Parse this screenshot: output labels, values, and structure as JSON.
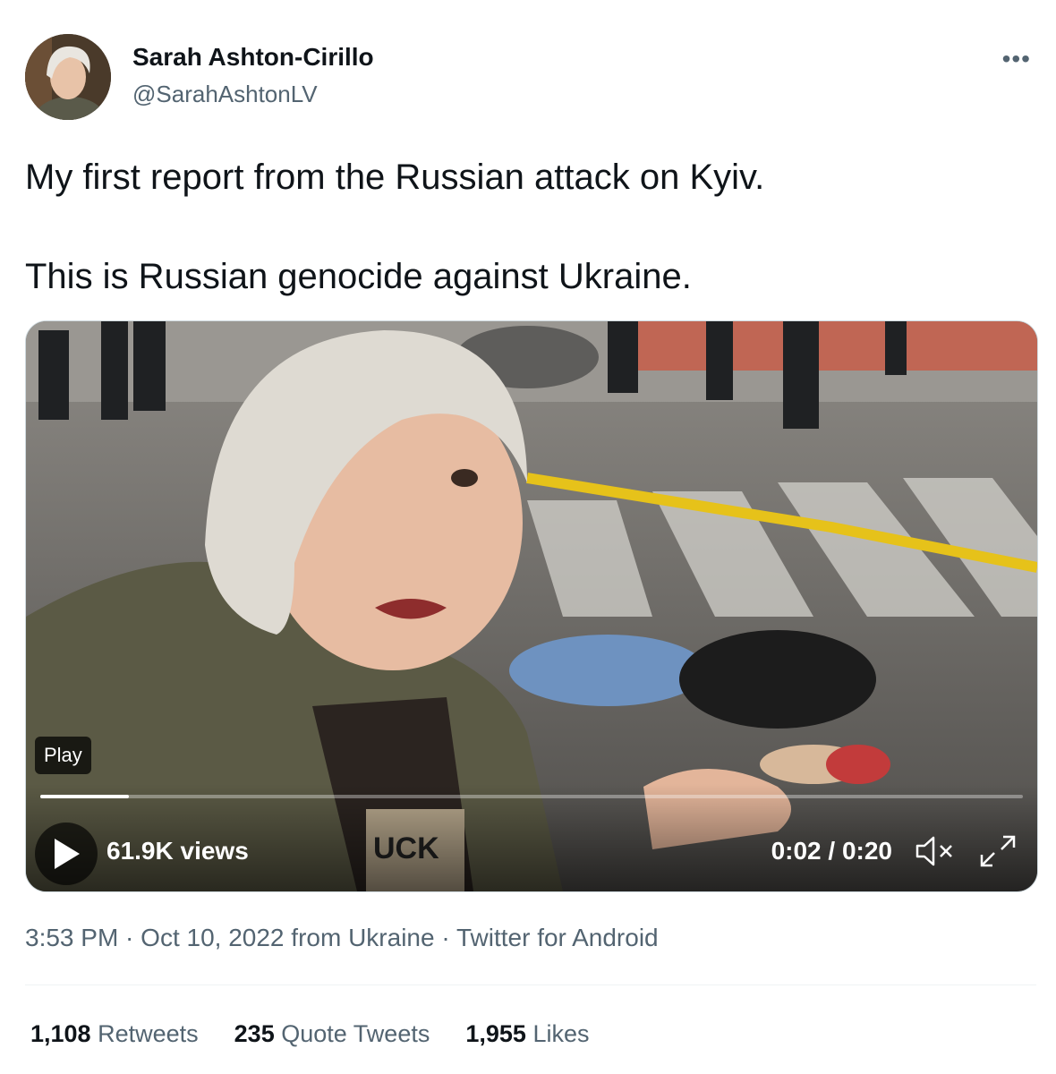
{
  "author": {
    "name": "Sarah Ashton-Cirillo",
    "handle": "@SarahAshtonLV",
    "avatar_icon": "avatar"
  },
  "more_icon": "•••",
  "tweet": {
    "line1": "My first report from the Russian attack on Kyiv.",
    "line2": "This is Russian genocide against Ukraine."
  },
  "video": {
    "badge": "Play",
    "views": "61.9K views",
    "time": "0:02 / 0:20",
    "progress_fraction": 0.09,
    "shirt_text": "UCK"
  },
  "meta": {
    "time": "3:53 PM",
    "date": "Oct 10, 2022",
    "location": "from Ukraine",
    "client": "Twitter for Android",
    "sep": " · "
  },
  "stats": {
    "retweets_count": "1,108",
    "retweets_label": "Retweets",
    "quotes_count": "235",
    "quotes_label": "Quote Tweets",
    "likes_count": "1,955",
    "likes_label": "Likes"
  },
  "colors": {
    "text": "#0f1419",
    "secondary": "#536471",
    "hose": "#e6c21a"
  }
}
